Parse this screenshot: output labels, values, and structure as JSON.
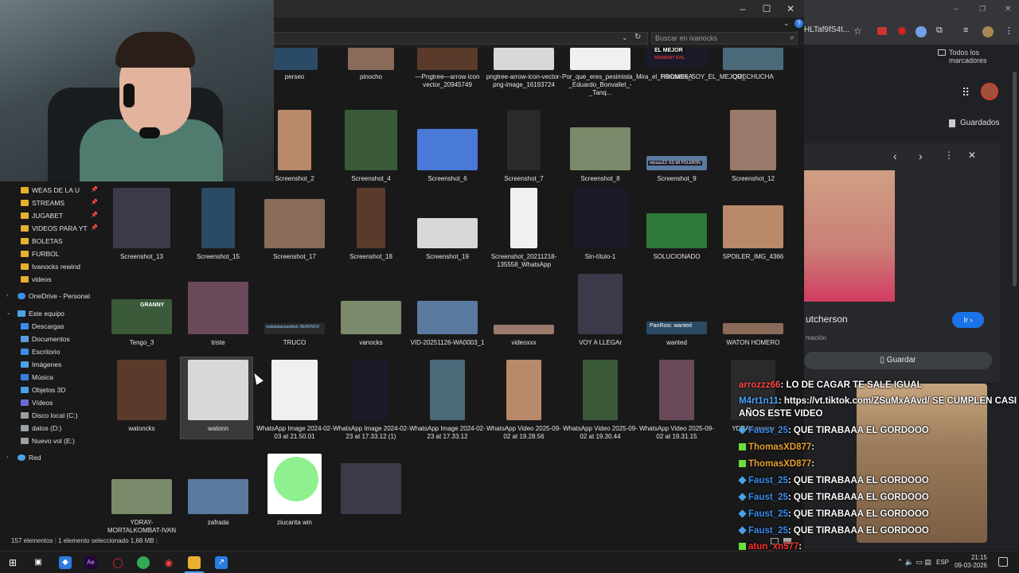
{
  "explorer": {
    "search_placeholder": "Buscar en ivanocks",
    "status": {
      "count": "157 elementos",
      "selected": "1 elemento seleccionado",
      "size": "1,68 MB"
    },
    "window_controls": {
      "minimize": "–",
      "maximize": "☐",
      "close": "✕"
    }
  },
  "sidebar": {
    "quick_access": [
      {
        "label": "WEAS DE LA U",
        "pinned": true
      },
      {
        "label": "STREAMS",
        "pinned": true
      },
      {
        "label": "JUGABET",
        "pinned": true
      },
      {
        "label": "VIDEOS PARA YT",
        "pinned": true
      },
      {
        "label": "BOLETAS",
        "pinned": false
      },
      {
        "label": "FURBOL",
        "pinned": false
      },
      {
        "label": "Ivanocks rewind",
        "pinned": false
      },
      {
        "label": "videos",
        "pinned": false
      }
    ],
    "onedrive": "OneDrive - Personal",
    "this_pc": "Este equipo",
    "pc_items": [
      "Descargas",
      "Documentos",
      "Escritorio",
      "Imágenes",
      "Música",
      "Objetos 3D",
      "Vídeos",
      "Disco local (C:)",
      "datos (D:)",
      "Nuevo vol (E:)"
    ],
    "network": "Red"
  },
  "files": [
    {
      "label": "perseo"
    },
    {
      "label": "pinocho"
    },
    {
      "label": "—Pngtree—arrow icon vector_20945749"
    },
    {
      "label": "pngtree-arrow-icon-vector-png-image_16193724"
    },
    {
      "label": "Por_que_eres_pesimista_Mira_el_Horizonte_SOY_EL_MEJOR_-_Eduardo_Bonvallet_-_Tanq..."
    },
    {
      "label": "PROMESA"
    },
    {
      "label": "QUECHUCHA"
    },
    {
      "label": "Screenshot_2"
    },
    {
      "label": "Screenshot_4"
    },
    {
      "label": "Screenshot_6"
    },
    {
      "label": "Screenshot_7"
    },
    {
      "label": "Screenshot_8"
    },
    {
      "label": "Screenshot_9"
    },
    {
      "label": "Screenshot_12"
    },
    {
      "label": "Screenshot_13"
    },
    {
      "label": "Screenshot_15"
    },
    {
      "label": "Screenshot_17"
    },
    {
      "label": "Screenshot_18"
    },
    {
      "label": "Screenshot_19"
    },
    {
      "label": "Screenshot_20211218-135558_WhatsApp"
    },
    {
      "label": "Sin-título-1"
    },
    {
      "label": "SOLUCIONADO"
    },
    {
      "label": "SPOILER_IMG_4366"
    },
    {
      "label": "Tengo_3"
    },
    {
      "label": "triste"
    },
    {
      "label": "TRUCO"
    },
    {
      "label": "vanocks"
    },
    {
      "label": "VID-20251126-WA0003_1"
    },
    {
      "label": "videoxxx"
    },
    {
      "label": "VOY A LLEGAr"
    },
    {
      "label": "wanted"
    },
    {
      "label": "WATON HOMERO"
    },
    {
      "label": "watoncks"
    },
    {
      "label": "watonn"
    },
    {
      "label": "WhatsApp Image 2024-02-03 at 21.50.01"
    },
    {
      "label": "WhatsApp Image 2024-02-23 at 17.33.12 (1)"
    },
    {
      "label": "WhatsApp Image 2024-02-23 at 17.33.12"
    },
    {
      "label": "WhatsApp Video 2025-09-02 at 19.28.56"
    },
    {
      "label": "WhatsApp Video 2025-09-02 at 19.30.44"
    },
    {
      "label": "WhatsApp Video 2025-09-02 at 19.31.15"
    },
    {
      "label": "YDRAY-granny"
    },
    {
      "label": "YDRAY-MORTALKOMBAT-IVAN"
    },
    {
      "label": "zafrada"
    },
    {
      "label": "ziucarita win"
    }
  ],
  "thumb_texts": {
    "promesa": "EL MEJOR",
    "promesa_sub": "RESIDENT EVIL",
    "screenshot9": "mizuuu12: ES MI POLERON",
    "truco": "matiasbasquetbolc BEKKNOV",
    "wanted": "PanRosi: wanted",
    "granny": "GRANNY"
  },
  "browser": {
    "url": "HLTaf9fS4t...",
    "bookmarks": "Todos los marcadores",
    "saved": "Guardados",
    "result_name": "utcherson",
    "result_sub": "mación",
    "go_button": "Ir",
    "save_button": "Guardar"
  },
  "chat": [
    {
      "user": "arrozzz66",
      "msg": ": LO DE CAGAR TE SALE IGUAL",
      "color": "#ff4a4a",
      "badge": ""
    },
    {
      "user": "M4rt1n11",
      "msg": ": https://vt.tiktok.com/ZSuMxAAvd/ SE CUMPLEN CASI 2",
      "color": "#4aa3ff",
      "badge": ""
    },
    {
      "user": "",
      "msg": "AÑOS ESTE VIDEO",
      "color": "#ffffff",
      "badge": ""
    },
    {
      "user": "Faust_25",
      "msg": ": QUE TIRABAAA EL GORDOOO",
      "color": "#3b8ef0",
      "badge": "diamond"
    },
    {
      "user": "ThomasXD877",
      "msg": ":",
      "color": "#e6a030",
      "badge": "star"
    },
    {
      "user": "ThomasXD877",
      "msg": ":",
      "color": "#e6a030",
      "badge": "star"
    },
    {
      "user": "Faust_25",
      "msg": ": QUE TIRABAAA EL GORDOOO",
      "color": "#3b8ef0",
      "badge": "diamond"
    },
    {
      "user": "Faust_25",
      "msg": ": QUE TIRABAAA EL GORDOOO",
      "color": "#3b8ef0",
      "badge": "diamond"
    },
    {
      "user": "Faust_25",
      "msg": ": QUE TIRABAAA EL GORDOOO",
      "color": "#3b8ef0",
      "badge": "diamond"
    },
    {
      "user": "Faust_25",
      "msg": ": QUE TIRABAAA EL GORDOOO",
      "color": "#3b8ef0",
      "badge": "diamond"
    },
    {
      "user": "atun_xn577",
      "msg": ":",
      "color": "#ff3030",
      "badge": "star"
    }
  ],
  "taskbar": {
    "lang": "ESP",
    "time": "21:15",
    "date": "09-03-2026"
  }
}
